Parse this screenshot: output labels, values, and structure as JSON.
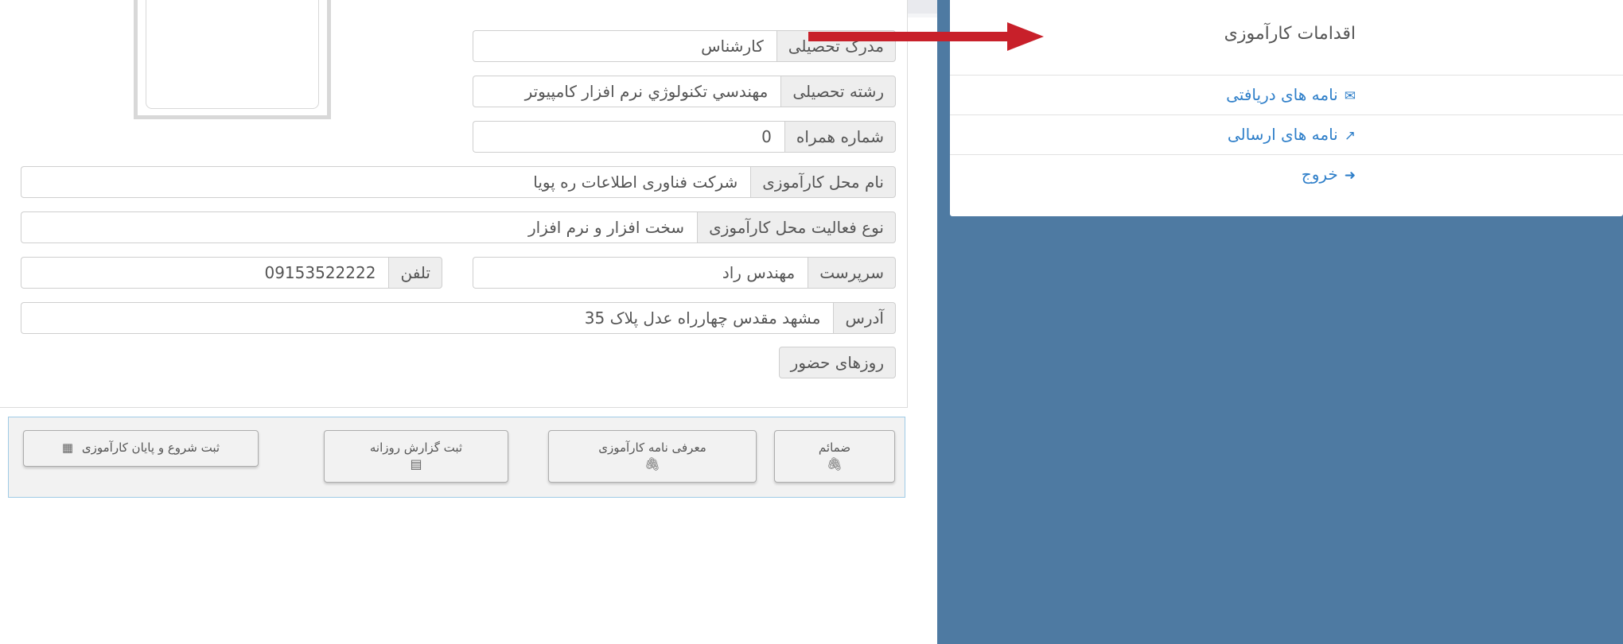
{
  "sidebar": {
    "title": "اقدامات کارآموزی",
    "items": [
      {
        "label": "نامه های دریافتی",
        "icon": "envelope-icon",
        "glyph": "✉"
      },
      {
        "label": "نامه های ارسالی",
        "icon": "share-icon",
        "glyph": "↗"
      },
      {
        "label": "خروج",
        "icon": "sign-out-icon",
        "glyph": "➜"
      }
    ]
  },
  "form": {
    "degree_label": "مدرک تحصیلی",
    "degree_value": "کارشناس",
    "major_label": "رشته تحصیلی",
    "major_value": "مهندسي تكنولوژي نرم افزار كامپيوتر",
    "mobile_label": "شماره همراه",
    "mobile_value": "0",
    "place_label": "نام محل کارآموزی",
    "place_value": "شرکت فناوری اطلاعات ره پویا",
    "activity_label": "نوع فعالیت محل کارآموزی",
    "activity_value": "سخت افزار و نرم افزار",
    "supervisor_label": "سرپرست",
    "supervisor_value": "مهندس راد",
    "phone_label": "تلفن",
    "phone_value": "09153522222",
    "address_label": "آدرس",
    "address_value": "مشهد مقدس چهارراه عدل پلاک 35",
    "days_label": "روزهای حضور"
  },
  "buttons": {
    "attachments": {
      "label": "ضمائم",
      "icon": "paperclip-icon",
      "glyph": "🖇"
    },
    "intro_letter": {
      "label": "معرفی نامه کارآموزی",
      "icon": "paperclip-icon",
      "glyph": "🖇"
    },
    "daily_report": {
      "label": "ثبت گزارش روزانه",
      "icon": "scroll-icon",
      "glyph": "▤"
    },
    "start_end": {
      "label": "ثبت شروع و پایان کارآموزی",
      "icon": "calendar-check-icon",
      "glyph": "▦"
    }
  },
  "colors": {
    "sidebar_bg": "#4e7aa2",
    "link": "#2f7fc9",
    "arrow": "#c8202a"
  }
}
